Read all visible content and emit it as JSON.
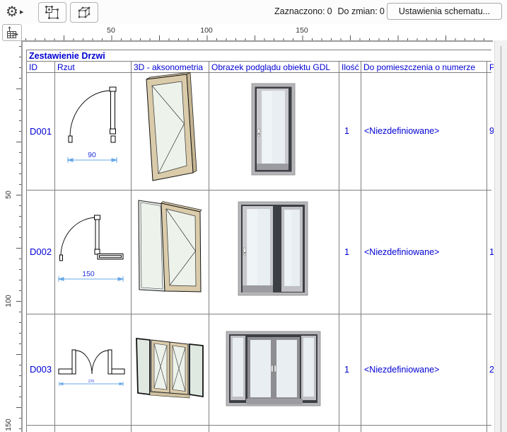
{
  "toolbar": {
    "status": {
      "selected_label": "Zaznaczono:",
      "selected_value": "0",
      "pending_label": "Do zmian:",
      "pending_value": "0"
    },
    "settings_button_label": "Ustawienia schematu..."
  },
  "rulers": {
    "horizontal": [
      "50",
      "100",
      "150"
    ],
    "vertical": [
      "50",
      "100",
      "150"
    ]
  },
  "schedule": {
    "title": "Zestawienie Drzwi",
    "headers": {
      "id": "ID",
      "plan": "Rzut",
      "axo": "3D - aksonometria",
      "gdl": "Obrazek podglądu obiektu GDL",
      "qty": "Ilość",
      "room": "Do pomieszczenia o numerze",
      "clipped": "P"
    },
    "rows": [
      {
        "id": "D001",
        "dim": "90",
        "qty": "1",
        "room": "<Niezdefiniowane>",
        "clipped": "9"
      },
      {
        "id": "D002",
        "dim": "150",
        "qty": "1",
        "room": "<Niezdefiniowane>",
        "clipped": "1"
      },
      {
        "id": "D003",
        "dim": "270",
        "qty": "1",
        "room": "<Niezdefiniowane>",
        "clipped": "2"
      }
    ]
  },
  "colors": {
    "text_blue": "#0000d4",
    "dim_line_blue": "#68a8e8",
    "dim_text_blue": "#2233dd",
    "grid_gray": "#7f7f7f",
    "frame_tan": "#dacbaa",
    "glass_green": "#edf2eb"
  }
}
